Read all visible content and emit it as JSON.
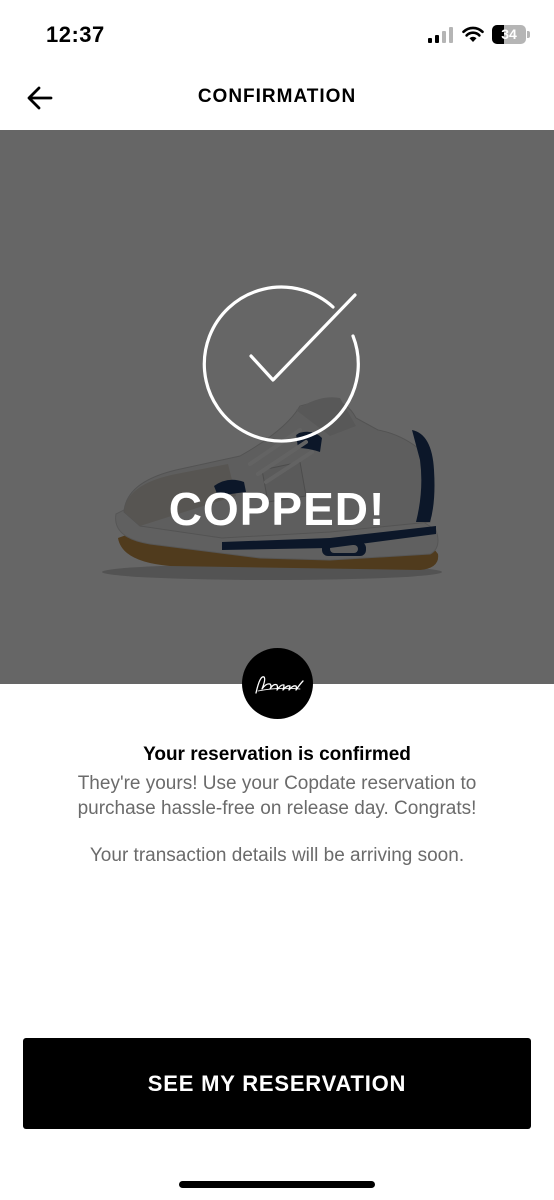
{
  "status_bar": {
    "time": "12:37",
    "battery_level": "34",
    "battery_percent": 34,
    "icons": [
      "signal-icon",
      "wifi-icon",
      "battery-icon"
    ]
  },
  "header": {
    "title": "CONFIRMATION",
    "back_icon": "arrow-left-icon"
  },
  "hero": {
    "headline": "COPPED!",
    "icon": "checkmark-circle-icon",
    "image": "sneaker-product-image"
  },
  "logo": {
    "icon": "signature-logo"
  },
  "content": {
    "heading": "Your reservation is confirmed",
    "body": "They're yours! Use your Copdate reservation to purchase hassle-free on release day. Congrats!",
    "note": "Your transaction details will be arriving soon."
  },
  "actions": {
    "primary_label": "SEE MY RESERVATION"
  },
  "colors": {
    "primary": "#000000",
    "background": "#ffffff",
    "secondary_text": "#6b6b6b",
    "shoe_accent": "#1f3b66",
    "sole_gum": "#c8934a"
  }
}
